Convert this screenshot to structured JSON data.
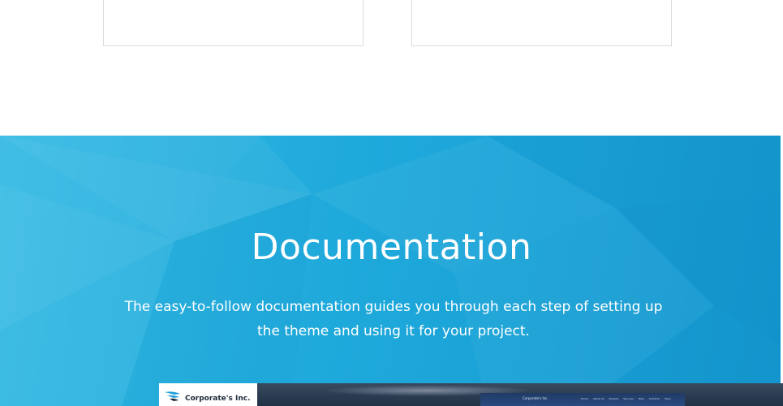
{
  "documentation": {
    "title": "Documentation",
    "description": "The easy-to-follow documentation guides you through each step of setting up the theme and using it for your project."
  },
  "preview": {
    "logo_text": "Corporate's Inc.",
    "mini_logo_text": "Corporate's Inc.",
    "mini_nav": [
      "Home",
      "About Us",
      "Projects",
      "Services",
      "Blog",
      "Contacts",
      "Shop"
    ]
  },
  "colors": {
    "band_light": "#33b9e3",
    "band_dark": "#1497cf",
    "accent": "#1e9fd8"
  },
  "icons": {
    "logo": "wing-logo-icon"
  }
}
